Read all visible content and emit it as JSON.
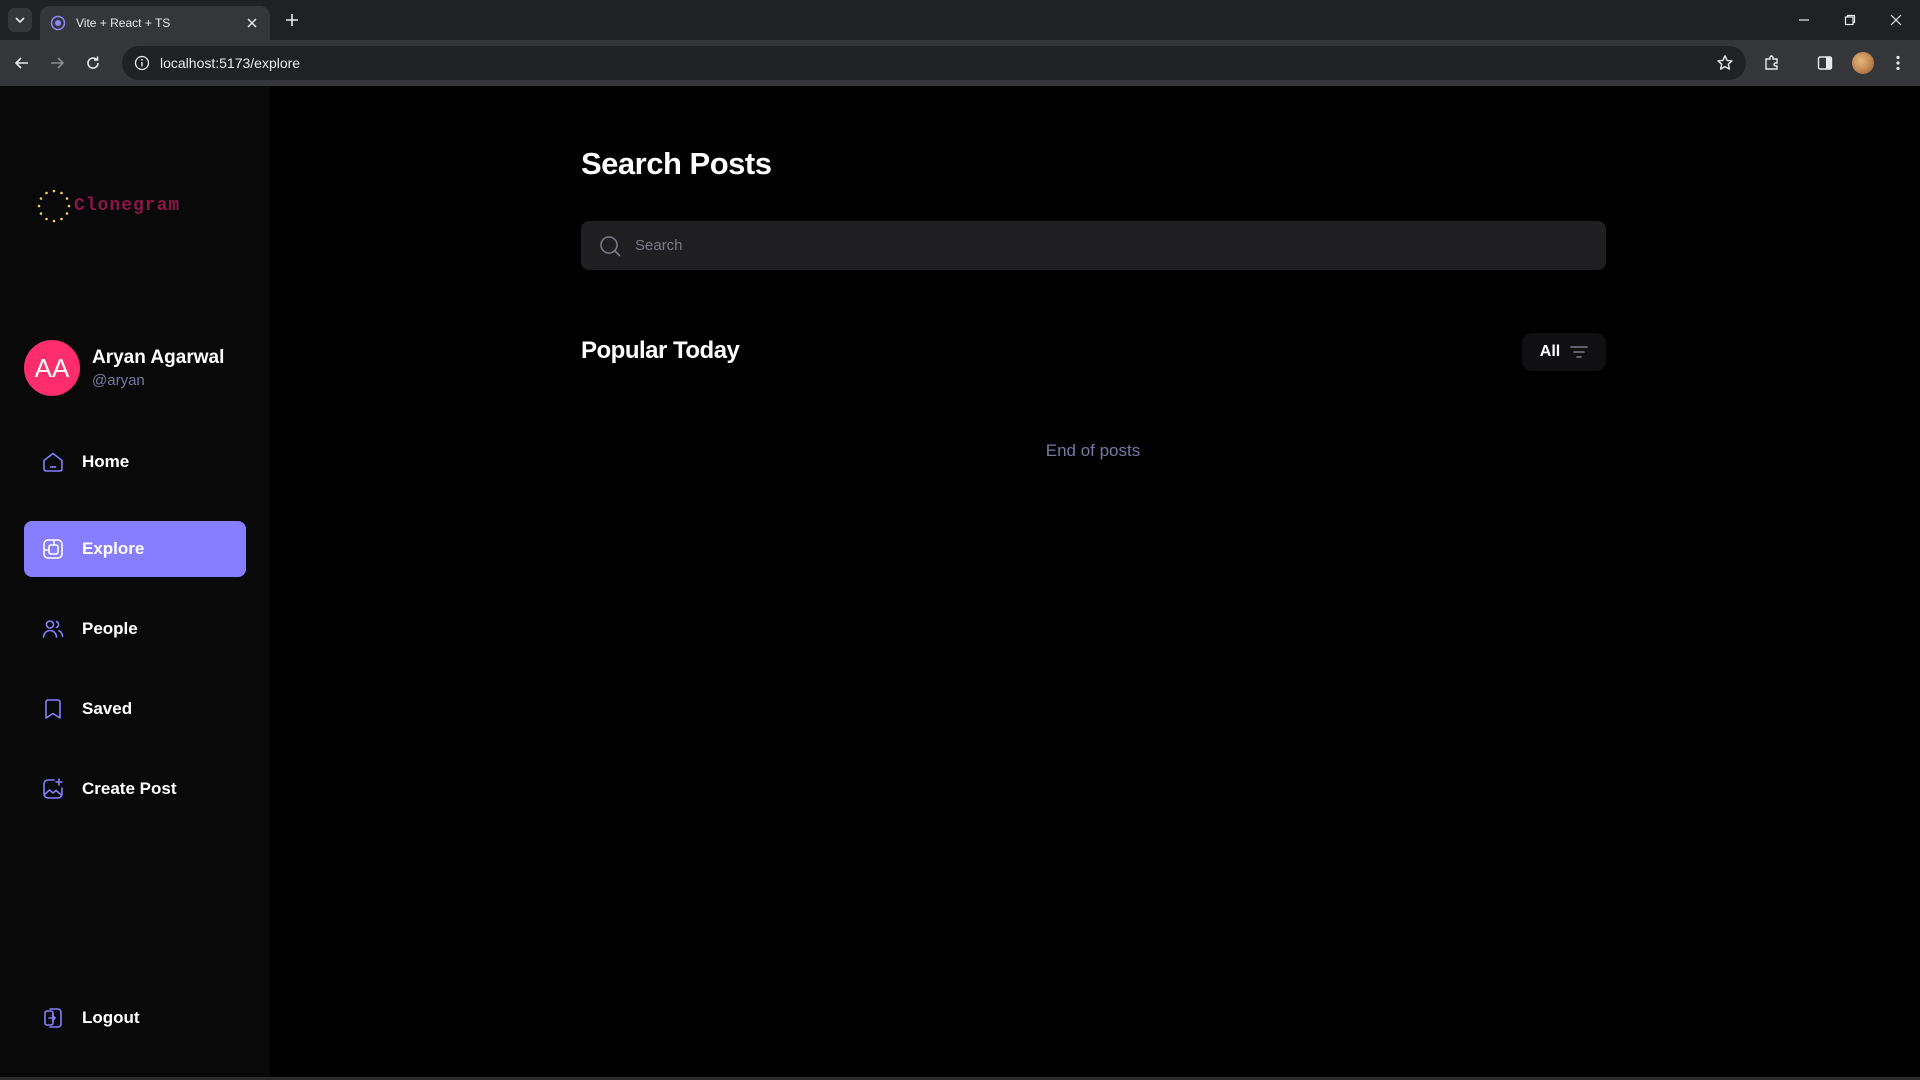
{
  "browser": {
    "tab_title": "Vite + React + TS",
    "url": "localhost:5173/explore"
  },
  "app": {
    "logo_text": "Clonegram",
    "user": {
      "initials": "AA",
      "name": "Aryan Agarwal",
      "handle": "@aryan"
    },
    "nav": [
      {
        "label": "Home",
        "icon": "home-icon",
        "active": false
      },
      {
        "label": "Explore",
        "icon": "explore-icon",
        "active": true
      },
      {
        "label": "People",
        "icon": "people-icon",
        "active": false
      },
      {
        "label": "Saved",
        "icon": "bookmark-icon",
        "active": false
      },
      {
        "label": "Create Post",
        "icon": "gallery-add-icon",
        "active": false
      }
    ],
    "logout_label": "Logout"
  },
  "main": {
    "title": "Search Posts",
    "search": {
      "placeholder": "Search",
      "value": ""
    },
    "section_title": "Popular Today",
    "filter_label": "All",
    "end_message": "End of posts"
  },
  "colors": {
    "accent": "#877eff",
    "avatar_bg": "#ff2d6b",
    "muted_text": "#7878a3",
    "logo_text": "#8a1746"
  }
}
